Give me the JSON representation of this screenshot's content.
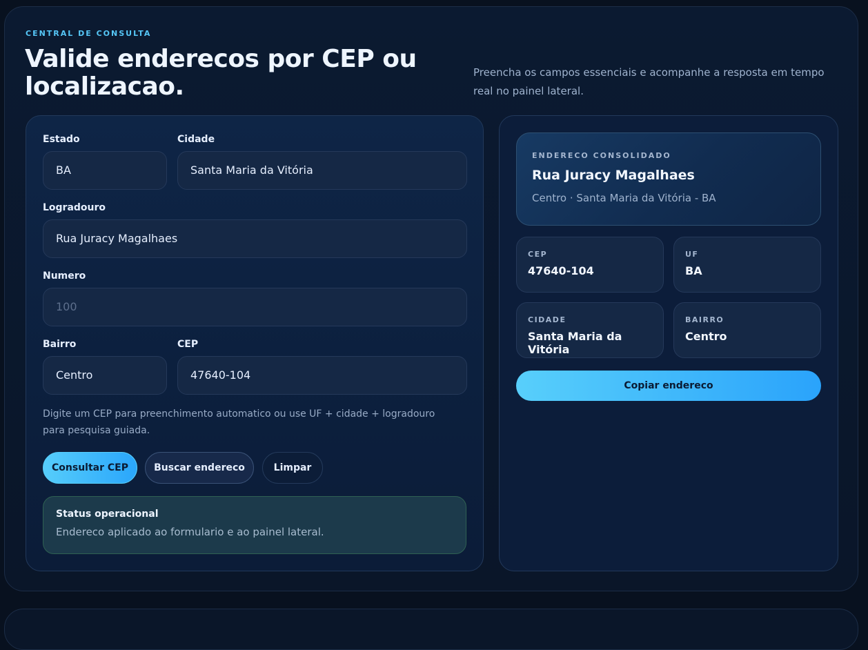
{
  "header": {
    "eyebrow": "CENTRAL DE CONSULTA",
    "title": "Valide enderecos por CEP ou localizacao.",
    "subtitle": "Preencha os campos essenciais e acompanhe a resposta em tempo real no painel lateral."
  },
  "form": {
    "estado": {
      "label": "Estado",
      "value": "BA"
    },
    "cidade": {
      "label": "Cidade",
      "value": "Santa Maria da Vitória"
    },
    "logradouro": {
      "label": "Logradouro",
      "value": "Rua Juracy Magalhaes"
    },
    "numero": {
      "label": "Numero",
      "placeholder": "100"
    },
    "bairro": {
      "label": "Bairro",
      "value": "Centro"
    },
    "cep": {
      "label": "CEP",
      "value": "47640-104"
    },
    "hint": "Digite um CEP para preenchimento automatico ou use UF + cidade + logradouro para pesquisa guiada.",
    "buttons": {
      "consultar": "Consultar CEP",
      "buscar": "Buscar endereco",
      "limpar": "Limpar"
    },
    "status": {
      "title": "Status operacional",
      "text": "Endereco aplicado ao formulario e ao painel lateral."
    }
  },
  "panel": {
    "eyebrow": "ENDERECO CONSOLIDADO",
    "title": "Rua Juracy Magalhaes",
    "subtitle": "Centro · Santa Maria da Vitória - BA",
    "cep": {
      "label": "CEP",
      "value": "47640-104"
    },
    "uf": {
      "label": "UF",
      "value": "BA"
    },
    "cidade": {
      "label": "CIDADE",
      "value": "Santa Maria da Vitória"
    },
    "bairro": {
      "label": "BAIRRO",
      "value": "Centro"
    },
    "copy_button": "Copiar endereco"
  }
}
